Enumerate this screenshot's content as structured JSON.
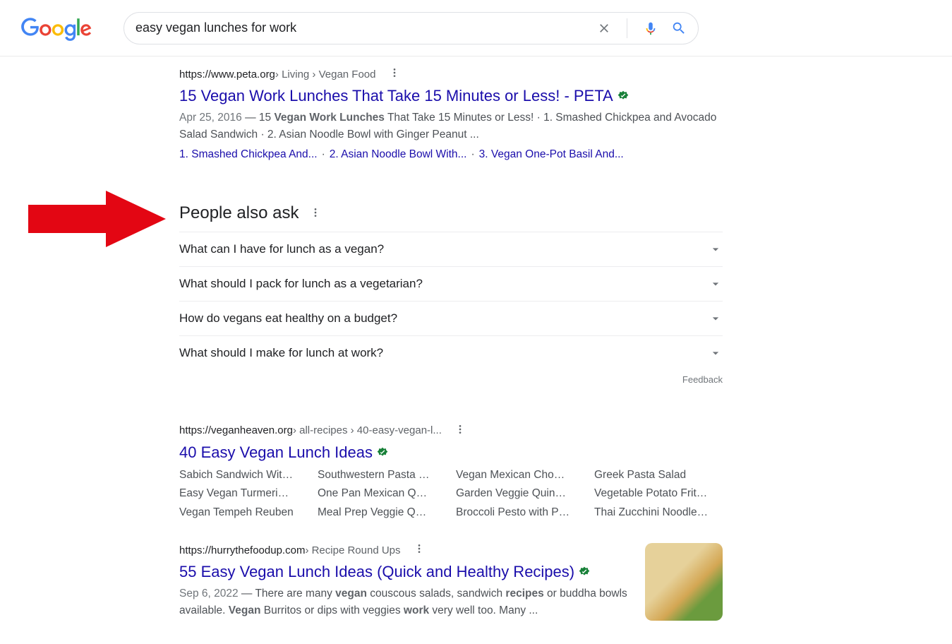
{
  "search": {
    "query": "easy vegan lunches for work"
  },
  "results": [
    {
      "domain": "https://www.peta.org",
      "path": " › Living › Vegan Food",
      "title": "15 Vegan Work Lunches That Take 15 Minutes or Less! - PETA",
      "date": "Apr 25, 2016",
      "snippet_before": " — 15 ",
      "snippet_bold": "Vegan Work Lunches",
      "snippet_after": " That Take 15 Minutes or Less! · 1. Smashed Chickpea and Avocado Salad Sandwich · 2. Asian Noodle Bowl with Ginger Peanut ...",
      "sitelinks": [
        "1. Smashed Chickpea And...",
        "2. Asian Noodle Bowl With...",
        "3. Vegan One-Pot Basil And..."
      ]
    },
    {
      "domain": "https://veganheaven.org",
      "path": " › all-recipes › 40-easy-vegan-l...",
      "title": "40 Easy Vegan Lunch Ideas",
      "cols": [
        [
          "Sabich Sandwich Wit…",
          "Easy Vegan Turmeri…",
          "Vegan Tempeh Reuben"
        ],
        [
          "Southwestern Pasta …",
          "One Pan Mexican Q…",
          "Meal Prep Veggie Q…"
        ],
        [
          "Vegan Mexican Cho…",
          "Garden Veggie Quin…",
          "Broccoli Pesto with P…"
        ],
        [
          "Greek Pasta Salad",
          "Vegetable Potato Frit…",
          "Thai Zucchini Noodle…"
        ]
      ]
    },
    {
      "domain": "https://hurrythefoodup.com",
      "path": " › Recipe Round Ups",
      "title": "55 Easy Vegan Lunch Ideas (Quick and Healthy Recipes)",
      "date": "Sep 6, 2022",
      "snip_parts": [
        " — There are many ",
        "vegan",
        " couscous salads, sandwich ",
        "recipes",
        " or buddha bowls available. ",
        "Vegan",
        " Burritos or dips with veggies ",
        "work",
        " very well too. Many ..."
      ]
    }
  ],
  "paa": {
    "title": "People also ask",
    "questions": [
      "What can I have for lunch as a vegan?",
      "What should I pack for lunch as a vegetarian?",
      "How do vegans eat healthy on a budget?",
      "What should I make for lunch at work?"
    ],
    "feedback": "Feedback"
  }
}
